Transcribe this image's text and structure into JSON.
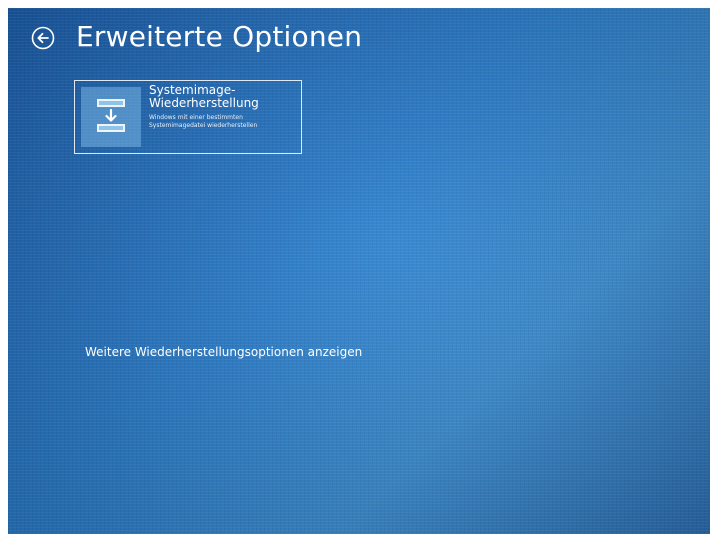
{
  "header": {
    "title": "Erweiterte Optionen",
    "back_icon": "back-arrow-circle-icon"
  },
  "options": [
    {
      "icon": "system-image-restore-icon",
      "title_line1": "Systemimage-",
      "title_line2": "Wiederherstellung",
      "description_line1": "Windows mit einer bestimmten",
      "description_line2": "Systemimagedatei wiederherstellen"
    }
  ],
  "footer": {
    "more_options_link": "Weitere Wiederherstellungsoptionen anzeigen"
  },
  "colors": {
    "background": "#2a7fcf",
    "text": "#ffffff"
  }
}
